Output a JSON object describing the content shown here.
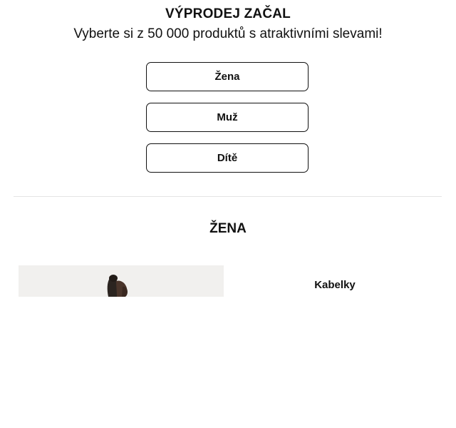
{
  "hero": {
    "title": "VÝPRODEJ ZAČAL",
    "subtitle": "Vyberte si z 50 000 produktů s atraktivními slevami!"
  },
  "categories": [
    {
      "label": "Žena"
    },
    {
      "label": "Muž"
    },
    {
      "label": "Dítě"
    }
  ],
  "section": {
    "title": "ŽENA",
    "tiles": [
      {
        "label": "Kabelky"
      }
    ]
  }
}
